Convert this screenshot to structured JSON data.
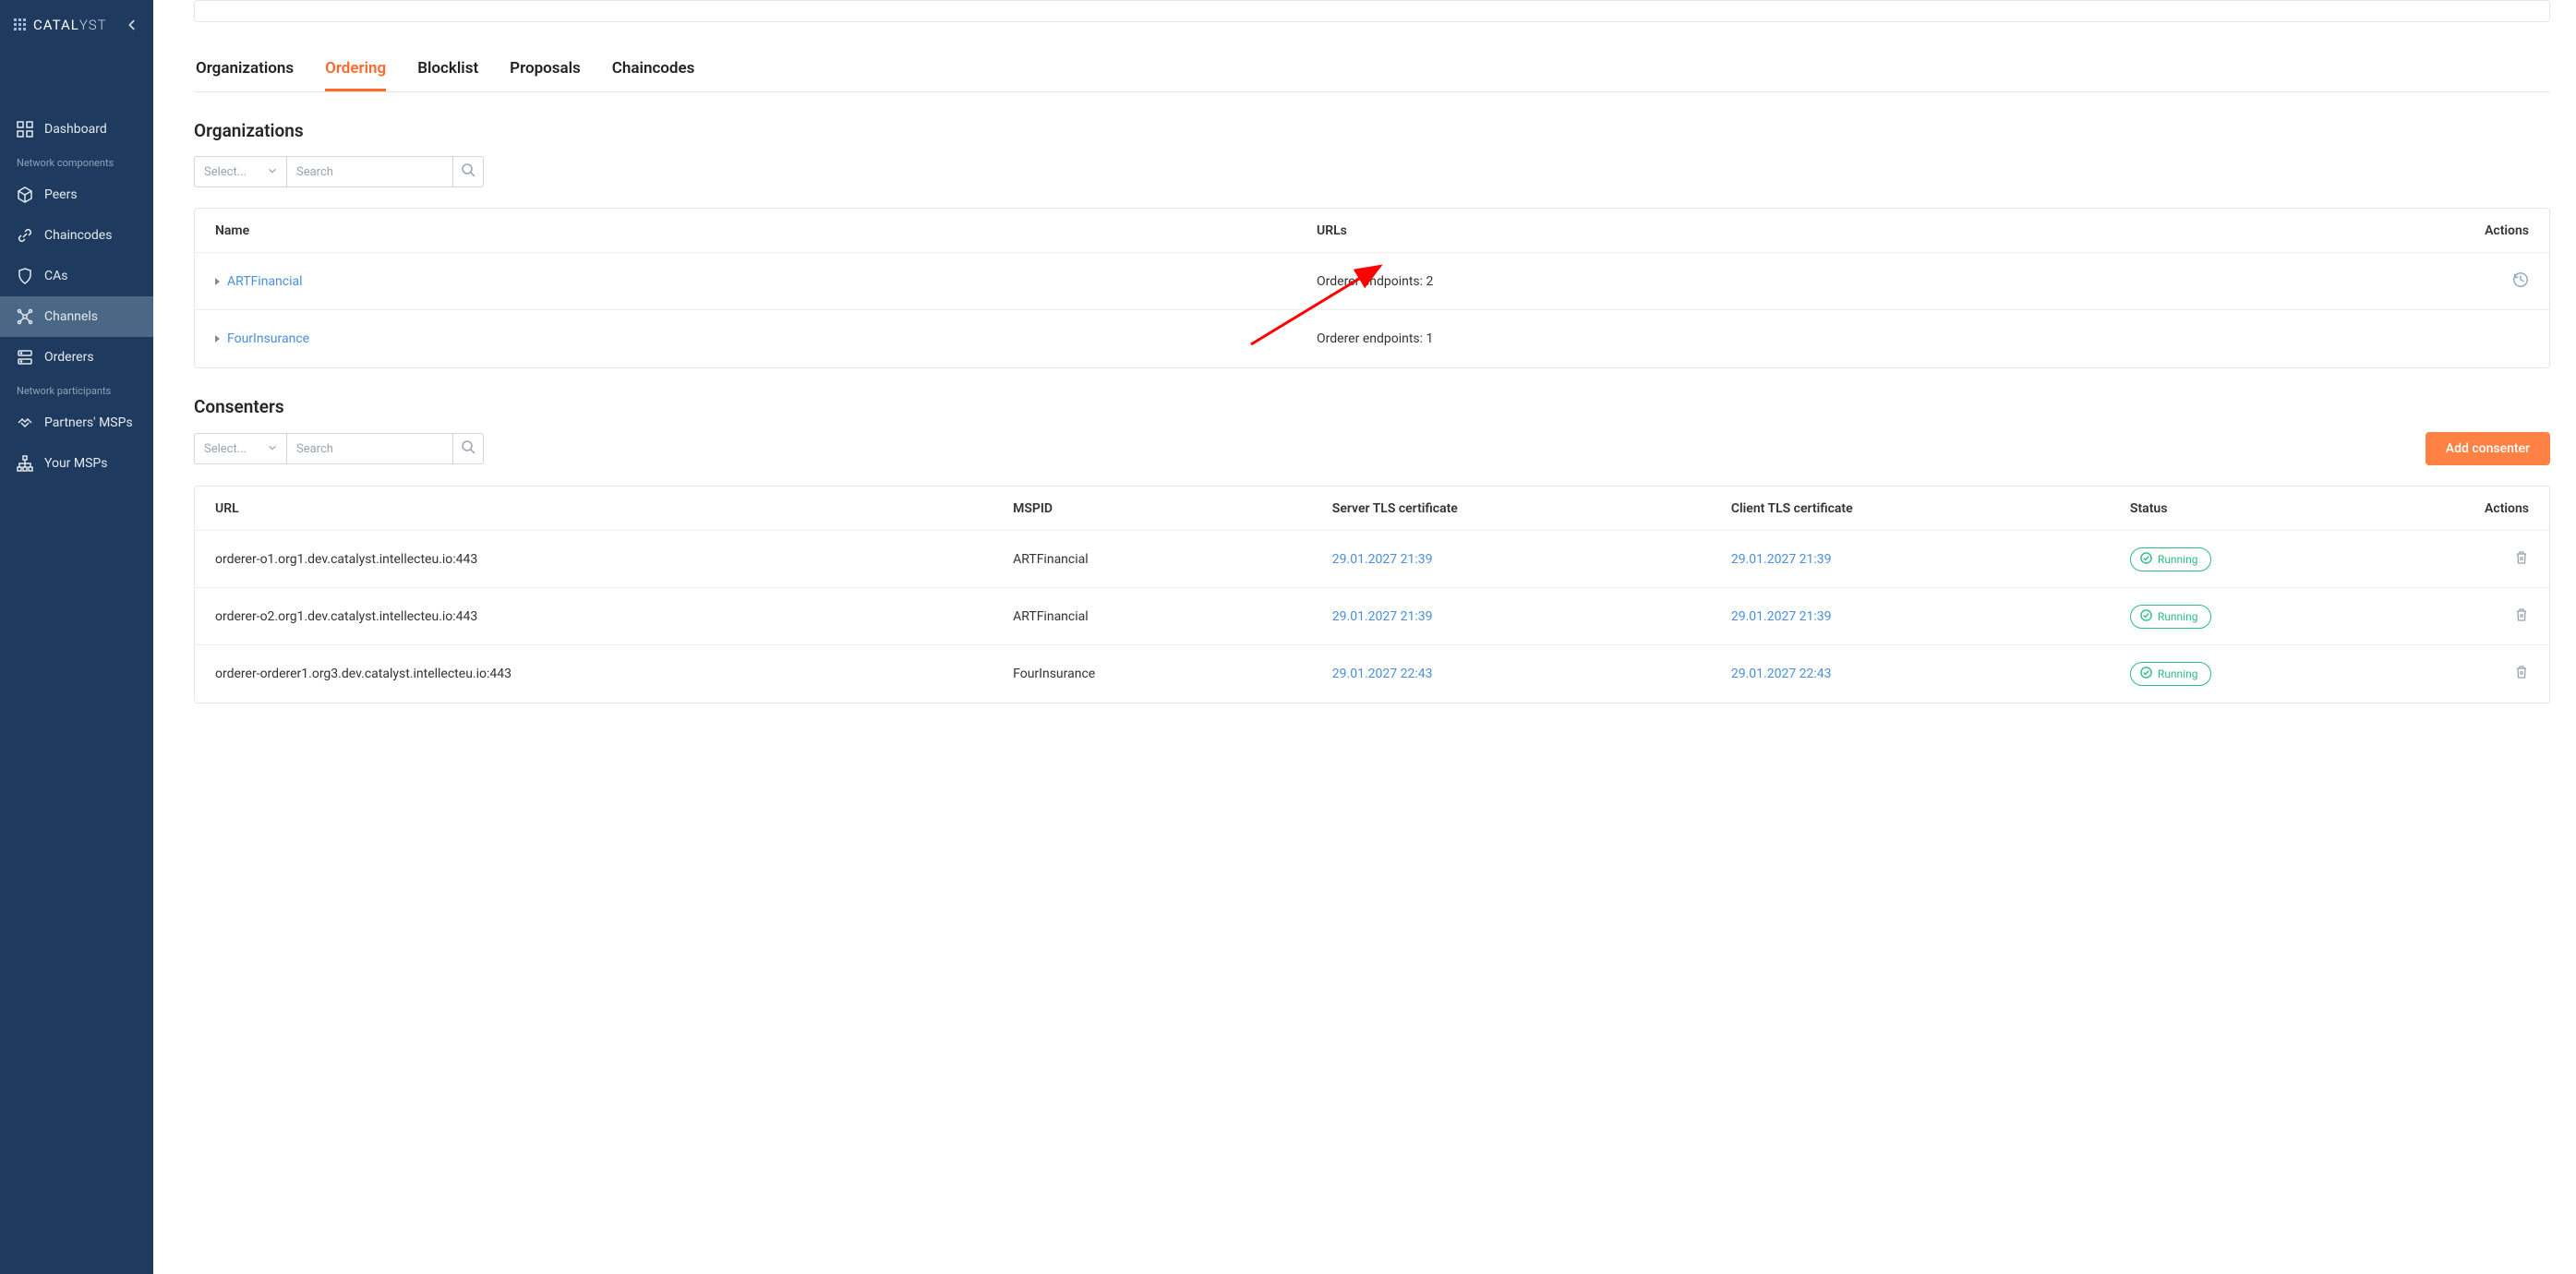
{
  "brand": {
    "prefix": "CATAL",
    "suffix": "YST"
  },
  "sidebar": {
    "items": [
      {
        "label": "Dashboard"
      }
    ],
    "network_components_label": "Network components",
    "components": [
      {
        "label": "Peers"
      },
      {
        "label": "Chaincodes"
      },
      {
        "label": "CAs"
      },
      {
        "label": "Channels"
      },
      {
        "label": "Orderers"
      }
    ],
    "network_participants_label": "Network participants",
    "participants": [
      {
        "label": "Partners' MSPs"
      },
      {
        "label": "Your MSPs"
      }
    ]
  },
  "tabs": {
    "organizations": "Organizations",
    "ordering": "Ordering",
    "blocklist": "Blocklist",
    "proposals": "Proposals",
    "chaincodes": "Chaincodes"
  },
  "sections": {
    "organizations_title": "Organizations",
    "consenters_title": "Consenters"
  },
  "filter": {
    "select_placeholder": "Select...",
    "search_placeholder": "Search"
  },
  "org_table": {
    "header": {
      "name": "Name",
      "urls": "URLs",
      "actions": "Actions"
    },
    "rows": [
      {
        "name": "ARTFinancial",
        "urls": "Orderer endpoints: 2"
      },
      {
        "name": "FourInsurance",
        "urls": "Orderer endpoints: 1"
      }
    ]
  },
  "consenters": {
    "add_label": "Add consenter",
    "header": {
      "url": "URL",
      "mspid": "MSPID",
      "server_tls": "Server TLS certificate",
      "client_tls": "Client TLS certificate",
      "status": "Status",
      "actions": "Actions"
    },
    "rows": [
      {
        "url": "orderer-o1.org1.dev.catalyst.intellecteu.io:443",
        "mspid": "ARTFinancial",
        "server_tls": "29.01.2027 21:39",
        "client_tls": "29.01.2027 21:39",
        "status": "Running"
      },
      {
        "url": "orderer-o2.org1.dev.catalyst.intellecteu.io:443",
        "mspid": "ARTFinancial",
        "server_tls": "29.01.2027 21:39",
        "client_tls": "29.01.2027 21:39",
        "status": "Running"
      },
      {
        "url": "orderer-orderer1.org3.dev.catalyst.intellecteu.io:443",
        "mspid": "FourInsurance",
        "server_tls": "29.01.2027 22:43",
        "client_tls": "29.01.2027 22:43",
        "status": "Running"
      }
    ]
  },
  "colors": {
    "accent": "#ff6a2b",
    "sidebar_bg": "#1e3a5f",
    "link": "#4a8fd9",
    "success": "#2dbd7f"
  }
}
